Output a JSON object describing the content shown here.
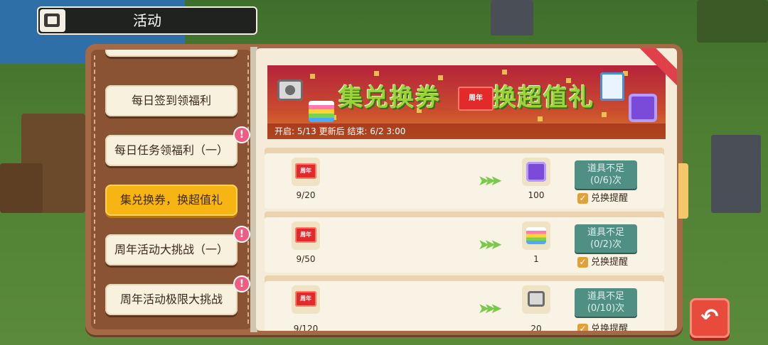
{
  "header": {
    "title": "活动"
  },
  "menu": {
    "items": [
      {
        "label": "每日签到领福利",
        "badge": ""
      },
      {
        "label": "每日任务领福利（一）",
        "badge": "!"
      },
      {
        "label": "集兑换券，换超值礼",
        "badge": "",
        "active": true
      },
      {
        "label": "周年活动大挑战（一）",
        "badge": "!"
      },
      {
        "label": "周年活动极限大挑战",
        "badge": "!"
      }
    ]
  },
  "banner": {
    "title_left": "集兑换券",
    "title_right": "换超值礼",
    "ticket_label": "周年",
    "info": "开启: 5/13 更新后 结束: 6/2  3:00"
  },
  "exchange_rows": [
    {
      "cost_label": "周年",
      "cost_count": "9/20",
      "reward_icon": "purple-cube-icon",
      "reward_count": "100",
      "button_line1": "道具不足",
      "button_line2": "(0/6)次",
      "remind_label": "兑换提醒"
    },
    {
      "cost_label": "周年",
      "cost_count": "9/50",
      "reward_icon": "rainbow-cake-icon",
      "reward_count": "1",
      "button_line1": "道具不足",
      "button_line2": "(0/2)次",
      "remind_label": "兑换提醒"
    },
    {
      "cost_label": "周年",
      "cost_count": "9/120",
      "reward_icon": "toolbox-icon",
      "reward_count": "20",
      "button_line1": "道具不足",
      "button_line2": "(0/10)次",
      "remind_label": "兑换提醒"
    }
  ],
  "colors": {
    "accent": "#f7b514",
    "button": "#4f8f84",
    "back": "#e84a3c",
    "banner": "#b5233a"
  }
}
